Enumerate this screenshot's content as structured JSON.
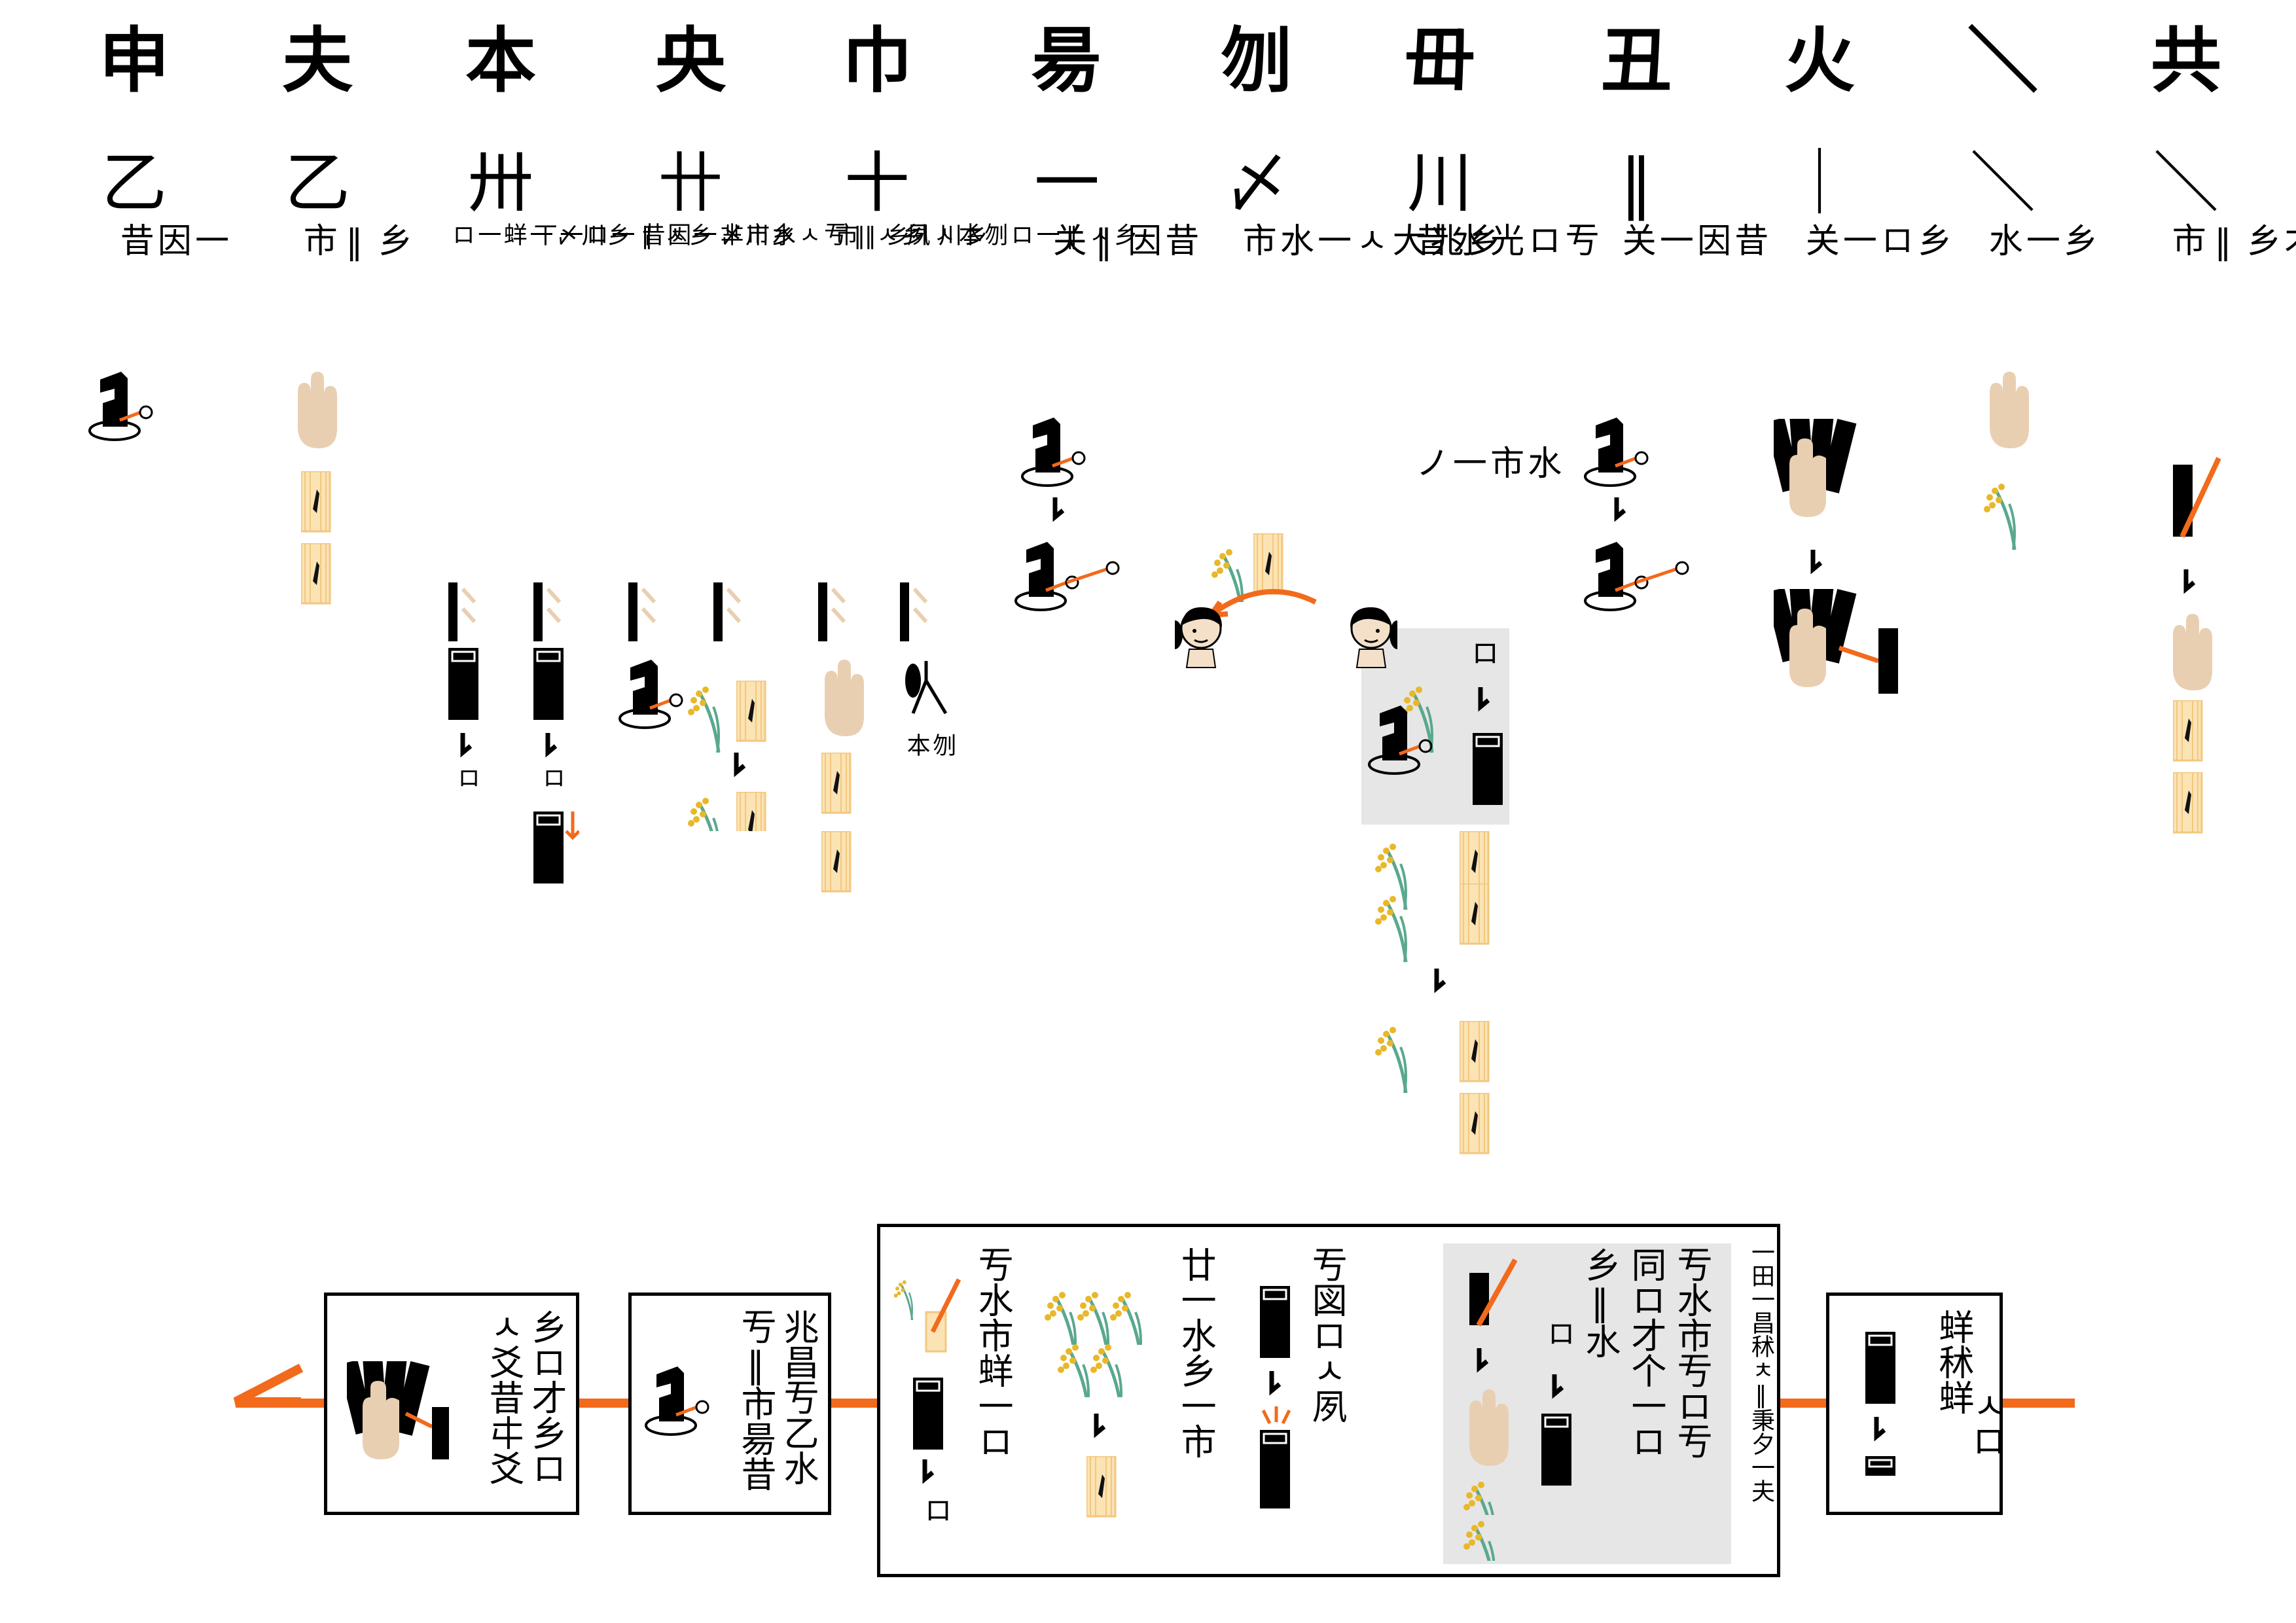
{
  "colors": {
    "accent": "#f26a1b",
    "black": "#000000",
    "skin": "#e9cfb1",
    "card": "#fbe3b4",
    "card_stripe": "#f3c77f",
    "rice": "#e8b82a",
    "stem": "#5aa88e",
    "panel": "#e6e6e6"
  },
  "columns": [
    {
      "title": "共",
      "number": "＼",
      "texts": [
        "同才乡‖市"
      ],
      "icons": [
        "stick-with-orange-rod-icon",
        "arrow-down-icon",
        "hand-icon",
        "card-icon",
        "card-icon"
      ]
    },
    {
      "title": "＼",
      "number": "＼",
      "texts": [
        "乡一水"
      ],
      "icons": [
        "hand-icon",
        "rice-plant-icon"
      ]
    },
    {
      "title": "火",
      "number": "｜",
      "texts": [
        "乡ロ一关"
      ],
      "icons": [
        "hand-holding-sticks-icon",
        "arrow-down-icon",
        "hand-holding-sticks-icon"
      ]
    },
    {
      "title": "丑",
      "number": "‖",
      "texts": [
        "昔因一关"
      ],
      "icons": [
        "dropped-stick-icon",
        "arrow-down-icon",
        "dropped-stick-icon"
      ]
    },
    {
      "title": "毌",
      "number": "川",
      "texts": [
        "亐ロ 光水昔",
        "水市一ノ"
      ],
      "icons": [
        "rice-plant-icon",
        "card-icon",
        "arrow-down-icon",
        "card-icon"
      ]
    },
    {
      "title": "刎",
      "number": "〆",
      "texts": [
        "乡兆大ㅅ一水市"
      ],
      "icons": [
        "card-icon",
        "rice-plant-icon",
        "person-icon",
        "person-icon"
      ]
    },
    {
      "title": "昜",
      "number": "一",
      "texts": [
        "昔因‖关"
      ],
      "icons": [
        "dropped-stick-icon",
        "arrow-down-icon",
        "dropped-stick-icon"
      ]
    },
    {
      "title": "巾",
      "number": "十",
      "texts": [
        "乡ㅅ‖ 一ロ刎本ㅅ夙",
        "乡川ㅣ 乡‖市"
      ],
      "icons": [
        "hand-icon",
        "card-icon",
        "card-icon",
        "fork-icon"
      ]
    },
    {
      "title": "央",
      "number": "卄",
      "texts": [
        "乡ㅅ‖ 亐ㅅ水市芈",
        "乡川〆 一因昔"
      ],
      "icons": [
        "dropped-stick-icon",
        "rice-plant-icon",
        "card-icon"
      ]
    },
    {
      "title": "本",
      "number": "卅",
      "texts": [
        "乡ㅅ‖ 一ロ一丅",
        "乡川〆 一蛘一ロ"
      ],
      "icons": [
        "stick-icon",
        "arrow-down-icon",
        "stick-icon"
      ]
    },
    {
      "title": "夫",
      "number": "乙",
      "texts": [
        "乡‖市"
      ],
      "icons": [
        "hand-icon",
        "card-icon",
        "card-icon"
      ]
    },
    {
      "title": "申",
      "number": "乙",
      "texts": [
        "一因昔"
      ],
      "icons": [
        "dropped-stick-icon"
      ]
    }
  ],
  "column5_panel_texts": [
    "ロ"
  ],
  "column5_below_texts": [],
  "column8_extra": [
    "刎本"
  ],
  "column10_extra": [
    "ロ",
    "ロ"
  ],
  "flow": {
    "box1_text": [
      "蛘秫蛘",
      "ㅅロ"
    ],
    "box2_title": "一田一昌秫ㅊ‖秉夕一夫",
    "box2_text": [
      "亐水市亐ロ亐",
      "同ロ才个一ロ",
      "乡‖水"
    ],
    "box2_inner_texts": [
      "ロ"
    ],
    "box2_mid_texts": [
      "亐図ロㅅ夙",
      "廿一水乡一市"
    ],
    "box2_left_texts": [
      "亐水市蛘一ロ",
      "ロ"
    ],
    "box3_text": [
      "兆昌亐乙水",
      "亐‖市昜昔"
    ],
    "box4_text": [
      "乡ロ才乡ロ",
      "ㅅ爻昔㐄爻"
    ]
  }
}
